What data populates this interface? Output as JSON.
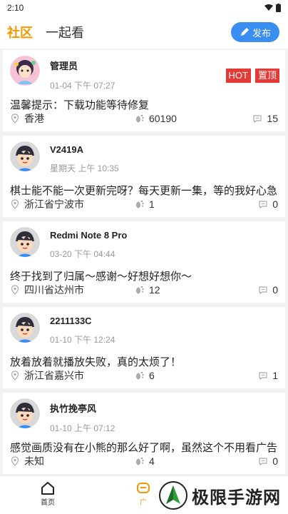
{
  "statusbar": {
    "time": "2:10"
  },
  "header": {
    "tabs": [
      {
        "label": "社区"
      },
      {
        "label": "一起看"
      }
    ],
    "publish_label": "发布"
  },
  "badges": {
    "hot": "HOT",
    "top": "置顶"
  },
  "posts": [
    {
      "name": "管理员",
      "time": "01-04 下午 07:27",
      "content": "温馨提示：下载功能等待修复",
      "location": "香港",
      "likes": "60190",
      "comments": "15"
    },
    {
      "name": "V2419A",
      "time": "星期天 上午 10:35",
      "content": "棋士能不能一次更新完呀？每天更新一集，等的我好心急",
      "location": "浙江省宁波市",
      "likes": "1",
      "comments": "0"
    },
    {
      "name": "Redmi Note 8 Pro",
      "time": "03-20 下午 04:44",
      "content": "终于找到了归属～感谢～好想好想你～",
      "location": "四川省达州市",
      "likes": "12",
      "comments": "0"
    },
    {
      "name": "2211133C",
      "time": "01-10 下午 12:24",
      "content": "放着放着就播放失败，真的太烦了！",
      "location": "浙江省嘉兴市",
      "likes": "6",
      "comments": "1"
    },
    {
      "name": "执竹挽亭风",
      "time": "01-10 上午 07:12",
      "content": "感觉画质没有在小熊的那么好了啊，虽然这个不用看广告",
      "location": "未知",
      "likes": "4",
      "comments": "0"
    }
  ],
  "bottomnav": {
    "home_label": "首页",
    "second_label": "广"
  },
  "watermark": {
    "text": "极限手游网"
  },
  "colors": {
    "accent": "#f39800",
    "publish": "#3a8ef2",
    "badge": "#e53935"
  }
}
